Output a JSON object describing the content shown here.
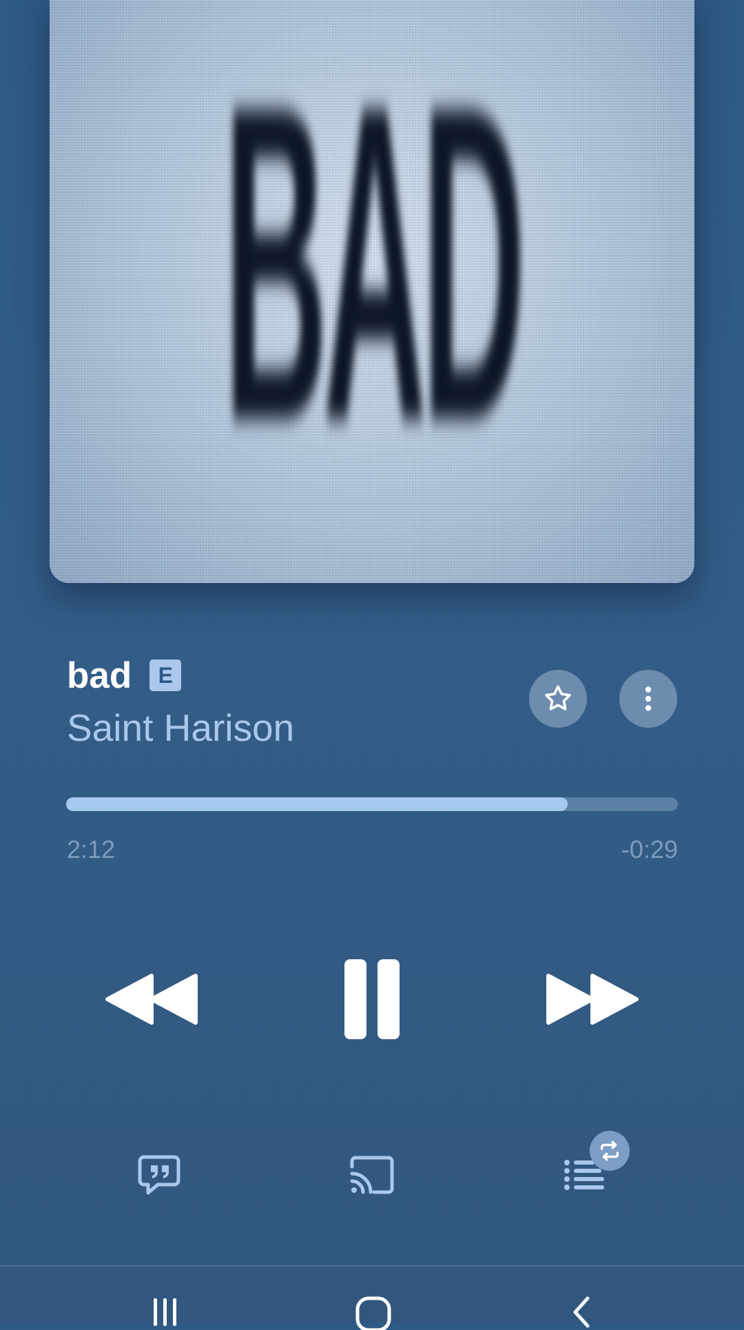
{
  "album": {
    "cover_text": "BAD"
  },
  "track": {
    "title": "bad",
    "explicit_label": "E",
    "artist": "Saint Harison"
  },
  "actions": {
    "favorite_icon": "star-outline-icon",
    "more_icon": "more-vertical-icon"
  },
  "playback": {
    "elapsed": "2:12",
    "remaining": "-0:29",
    "progress_fraction": 0.82,
    "state": "playing"
  },
  "controls": {
    "rewind_icon": "rewind-icon",
    "pause_icon": "pause-icon",
    "forward_icon": "fast-forward-icon"
  },
  "bottom_actions": {
    "lyrics_icon": "lyrics-icon",
    "cast_icon": "cast-icon",
    "queue_icon": "queue-icon",
    "repeat_icon": "repeat-icon"
  },
  "nav": {
    "recents_icon": "recent-apps-icon",
    "home_icon": "home-icon",
    "back_icon": "back-icon"
  },
  "colors": {
    "background": "#2f5a86",
    "accent": "#a9c8ec",
    "progress_fill": "#a6c9f0",
    "time_text": "#7d9cbf"
  }
}
